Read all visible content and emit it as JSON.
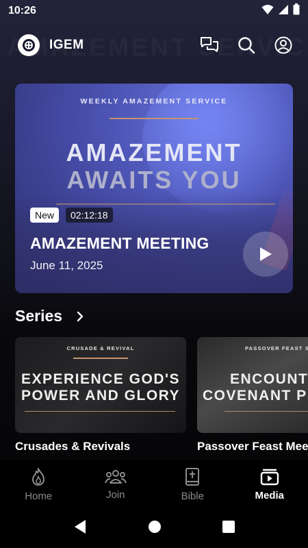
{
  "status_bar": {
    "time": "10:26"
  },
  "app_bar": {
    "title": "IGEM"
  },
  "hero": {
    "kicker": "WEEKLY AMAZEMENT SERVICE",
    "headline_line1": "AMAZEMENT",
    "headline_line2": "AWAITS YOU",
    "badge_new": "New",
    "duration": "02:12:18",
    "title": "AMAZEMENT MEETING",
    "date": "June 11, 2025"
  },
  "series": {
    "title": "Series",
    "items": [
      {
        "kicker": "CRUSADE & REVIVAL",
        "line1": "EXPERIENCE GOD'S",
        "line2": "POWER AND GLORY",
        "label": "Crusades & Revivals"
      },
      {
        "kicker": "PASSOVER FEAST SERV",
        "line1": "ENCOUNT",
        "line2": "COVENANT P",
        "label": "Passover Feast Meet"
      }
    ]
  },
  "bottom_nav": {
    "items": [
      {
        "label": "Home",
        "icon": "flame-icon",
        "active": false
      },
      {
        "label": "Join",
        "icon": "people-icon",
        "active": false
      },
      {
        "label": "Bible",
        "icon": "bible-icon",
        "active": false
      },
      {
        "label": "Media",
        "icon": "media-icon",
        "active": true
      }
    ]
  },
  "colors": {
    "accent_rule": "#c49470",
    "hero_blue": "#4d55b6",
    "inactive": "#8c8c8c"
  }
}
